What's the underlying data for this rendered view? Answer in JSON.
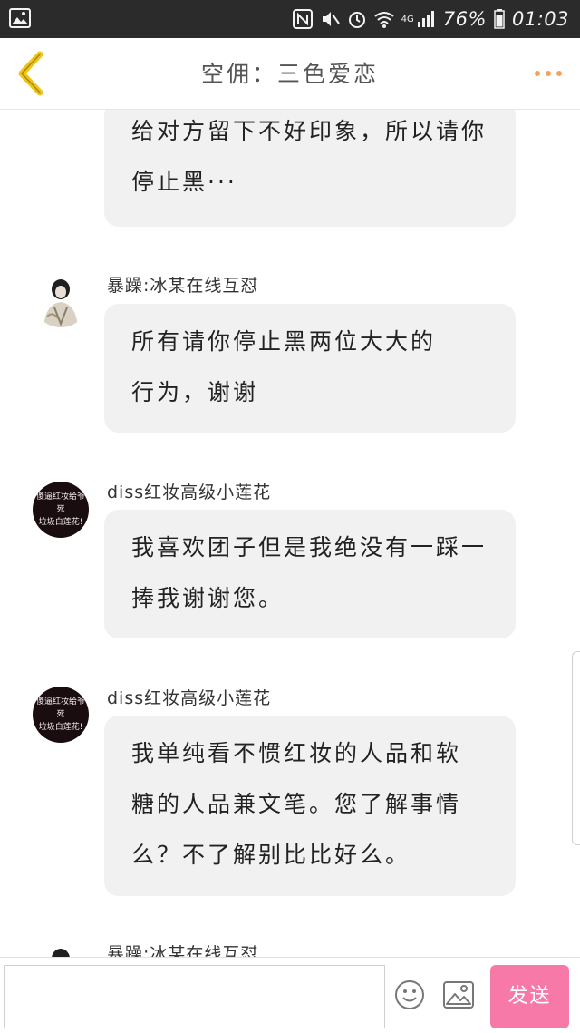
{
  "status_bar": {
    "battery": "76%",
    "time": "01:03",
    "network": "4G"
  },
  "header": {
    "title": "空佣：三色爱恋"
  },
  "messages": [
    {
      "sender": "",
      "lines": [
        "给对方留下不好印象，所以请你",
        "停止黑···"
      ]
    },
    {
      "sender": "暴躁:冰某在线互怼",
      "lines": [
        "所有请你停止黑两位大大的",
        "行为，谢谢"
      ]
    },
    {
      "sender": "diss红妆高级小莲花",
      "avatar_text": [
        "傻逼红妆给爷死",
        "垃圾白莲花!"
      ],
      "lines": [
        "我喜欢团子但是我绝没有一踩一",
        "捧我谢谢您。"
      ]
    },
    {
      "sender": "diss红妆高级小莲花",
      "avatar_text": [
        "傻逼红妆给爷死",
        "垃圾白莲花!"
      ],
      "lines": [
        "我单纯看不惯红妆的人品和软",
        "糖的人品兼文笔。您了解事情",
        "么？不了解别比比好么。"
      ]
    },
    {
      "sender": "暴躁:冰某在线互怼",
      "lines": []
    }
  ],
  "input": {
    "placeholder": "",
    "send_label": "发送"
  },
  "icons": {
    "back": "chevron-left-icon",
    "more": "more-dots-icon",
    "emoji": "smiley-icon",
    "image": "image-icon"
  },
  "colors": {
    "accent": "#f779a8",
    "back_arrow": "#f0c419",
    "more_dots": "#f2a25b"
  }
}
